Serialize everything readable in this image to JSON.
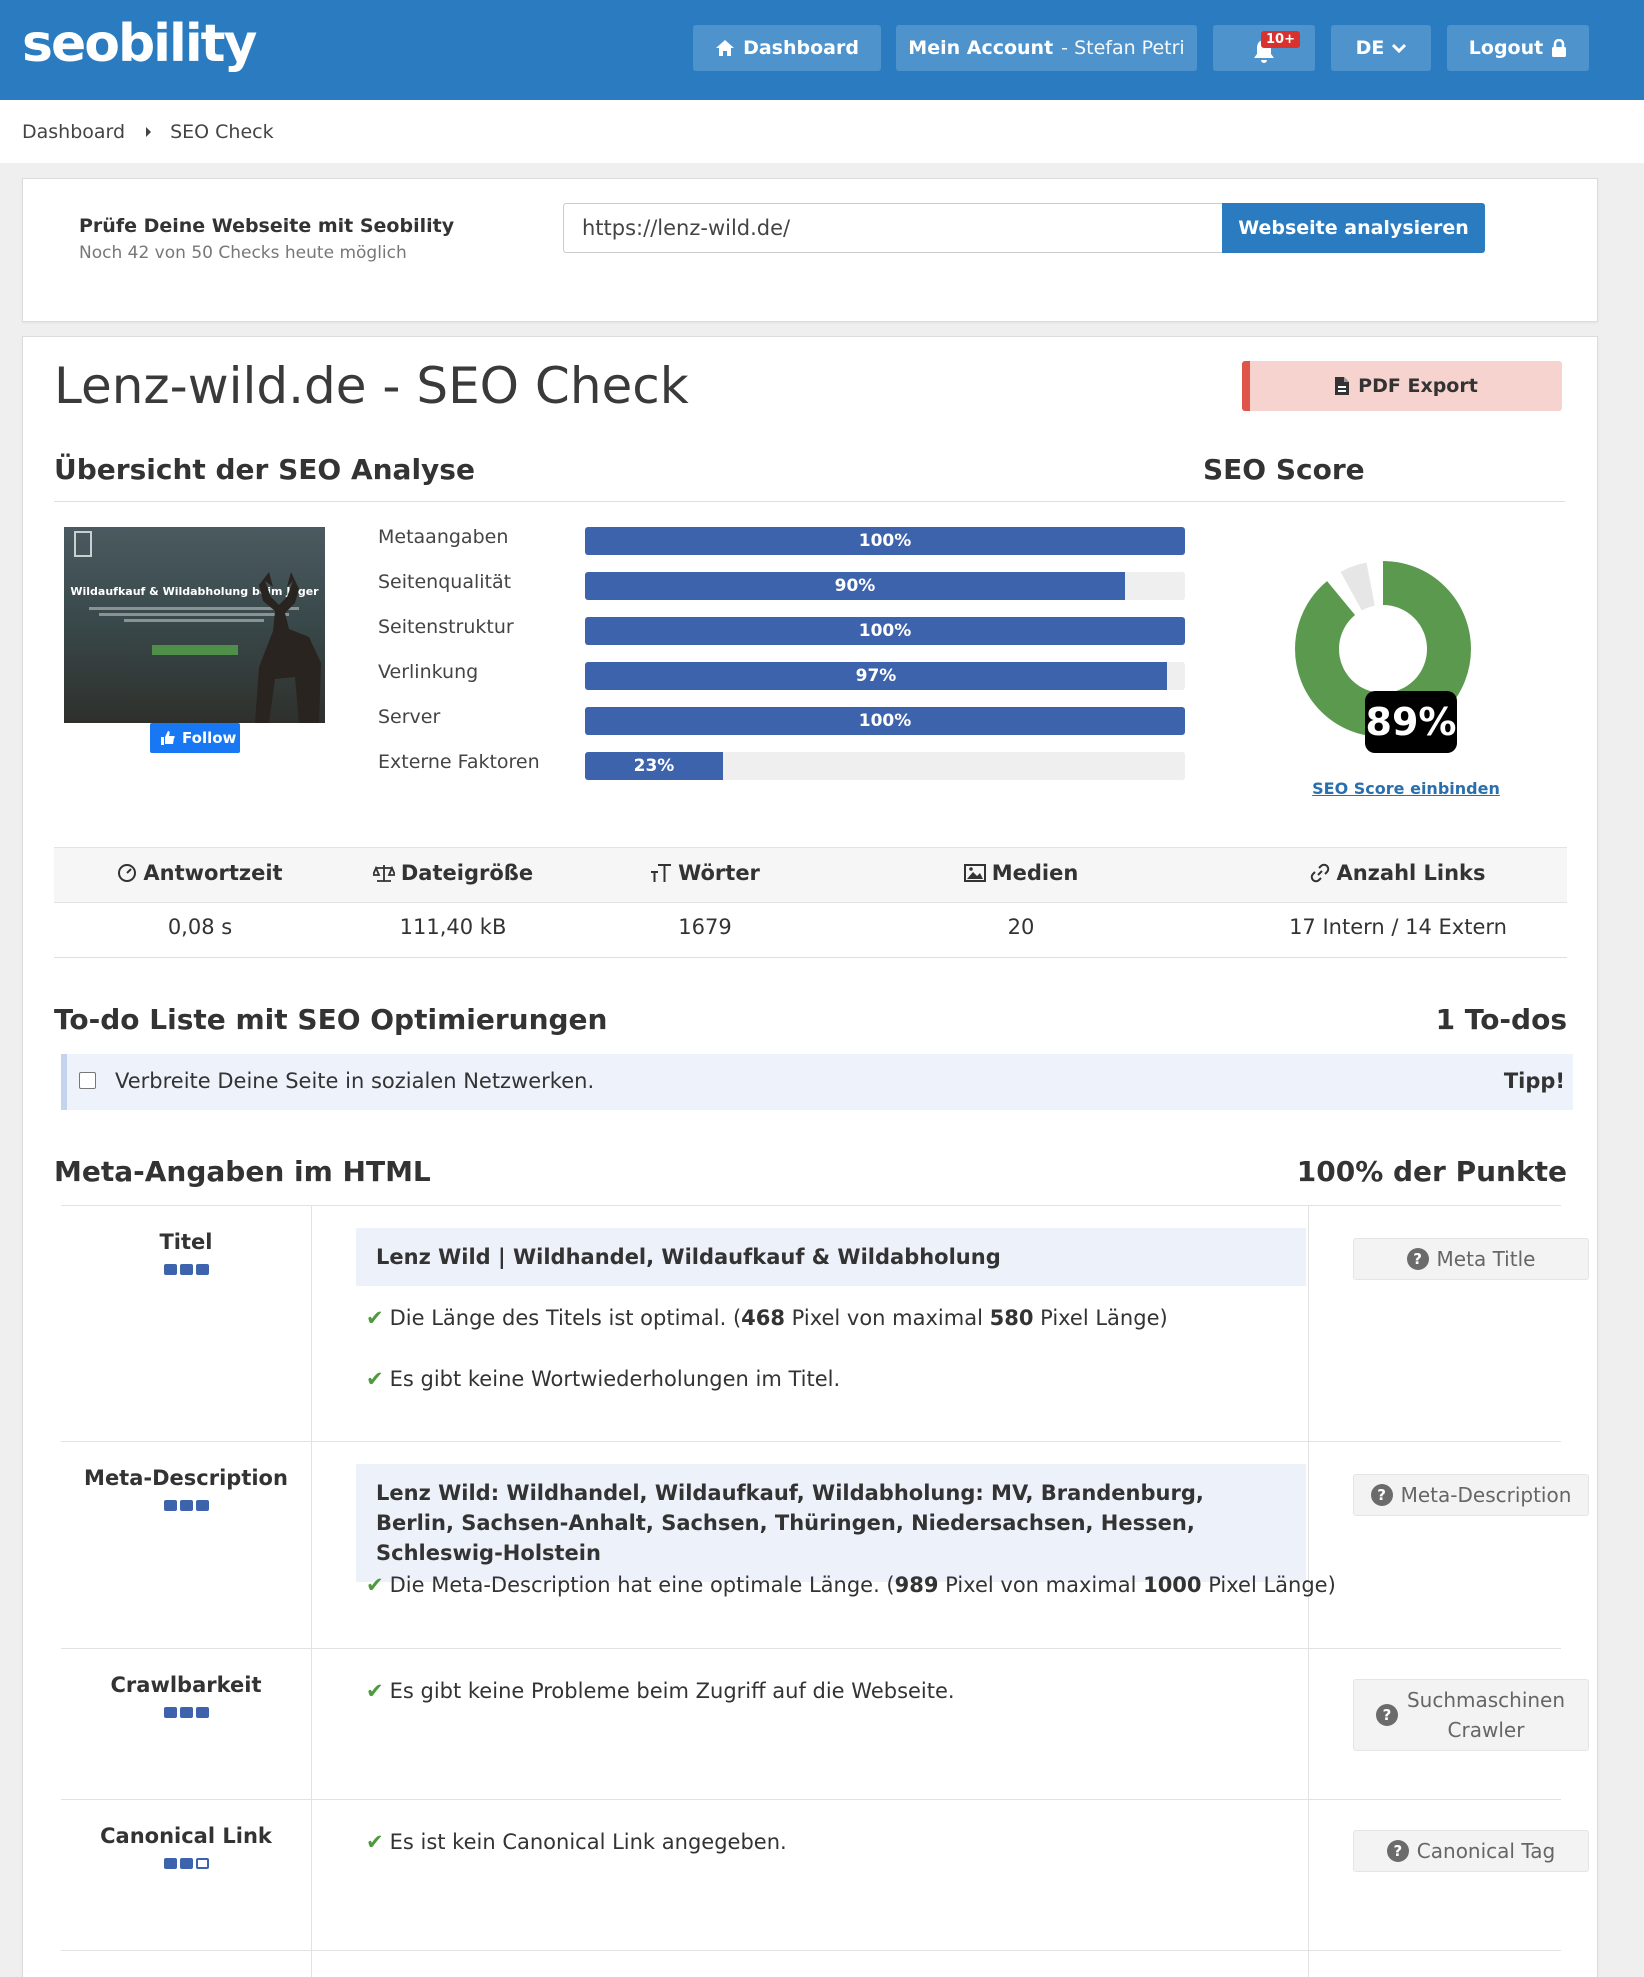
{
  "brand": {
    "logo": "seobility"
  },
  "nav": {
    "dashboard": "Dashboard",
    "account_label": "Mein Account",
    "account_user": " - Stefan Petri",
    "notifications_badge": "10+",
    "language": "DE",
    "logout": "Logout"
  },
  "breadcrumb": {
    "items": [
      "Dashboard",
      "SEO Check"
    ]
  },
  "checkform": {
    "title": "Prüfe Deine Webseite mit Seobility",
    "subtitle": "Noch 42 von 50 Checks heute möglich",
    "url_value": "https://lenz-wild.de/",
    "submit": "Webseite analysieren"
  },
  "report": {
    "title": "Lenz-wild.de - SEO Check",
    "pdf_export": "PDF Export",
    "overview_heading": "Übersicht der SEO Analyse",
    "score_heading": "SEO Score",
    "score_value": "89%",
    "score_percent": 89,
    "score_embed_link": "SEO Score einbinden",
    "thumbnail_headline": "Wildaufkauf & Wildabholung beim Jäger",
    "follow_button": "Follow",
    "bars": [
      {
        "label": "Metaangaben",
        "percent": 100,
        "text": "100%"
      },
      {
        "label": "Seitenqualität",
        "percent": 90,
        "text": "90%"
      },
      {
        "label": "Seitenstruktur",
        "percent": 100,
        "text": "100%"
      },
      {
        "label": "Verlinkung",
        "percent": 97,
        "text": "97%"
      },
      {
        "label": "Server",
        "percent": 100,
        "text": "100%"
      },
      {
        "label": "Externe Faktoren",
        "percent": 23,
        "text": "23%"
      }
    ],
    "stats": [
      {
        "label": "Antwortzeit",
        "value": "0,08 s",
        "icon": "gauge-icon"
      },
      {
        "label": "Dateigröße",
        "value": "111,40 kB",
        "icon": "scale-icon"
      },
      {
        "label": "Wörter",
        "value": "1679",
        "icon": "text-size-icon"
      },
      {
        "label": "Medien",
        "value": "20",
        "icon": "image-icon"
      },
      {
        "label": "Anzahl Links",
        "value": "17 Intern / 14 Extern",
        "icon": "link-icon"
      }
    ],
    "todo": {
      "heading": "To-do Liste mit SEO Optimierungen",
      "count": "1 To-dos",
      "items": [
        {
          "text": "Verbreite Deine Seite in sozialen Netzwerken.",
          "tag": "Tipp!"
        }
      ]
    },
    "meta": {
      "heading": "Meta-Angaben im HTML",
      "points": "100% der Punkte",
      "rows": [
        {
          "label": "Titel",
          "value": "Lenz Wild | Wildhandel, Wildaufkauf & Wildabholung",
          "checks": [
            {
              "pre": "Die Länge des Titels ist optimal. (",
              "b1": "468",
              "mid": " Pixel von maximal ",
              "b2": "580",
              "post": " Pixel Länge)"
            },
            {
              "text": "Es gibt keine Wortwiederholungen im Titel."
            }
          ],
          "help": "Meta Title"
        },
        {
          "label": "Meta-Description",
          "value": "Lenz Wild: Wildhandel, Wildaufkauf, Wildabholung: MV, Brandenburg, Berlin, Sachsen-Anhalt, Sachsen, Thüringen, Niedersachsen, Hessen, Schleswig-Holstein",
          "checks": [
            {
              "pre": "Die Meta-Description hat eine optimale Länge. (",
              "b1": "989",
              "mid": " Pixel von maximal ",
              "b2": "1000",
              "post": " Pixel Länge)"
            }
          ],
          "help": "Meta-Description"
        },
        {
          "label": "Crawlbarkeit",
          "checks": [
            {
              "text": "Es gibt keine Probleme beim Zugriff auf die Webseite."
            }
          ],
          "help": "Suchmaschinen Crawler"
        },
        {
          "label": "Canonical Link",
          "checks": [
            {
              "text": "Es ist kein Canonical Link angegeben."
            }
          ],
          "help": "Canonical Tag"
        }
      ]
    }
  },
  "colors": {
    "brand_blue": "#2a7bbf",
    "bar_blue": "#3e63ad",
    "score_green": "#5b9a4e",
    "pdf_red": "#e0554a"
  }
}
